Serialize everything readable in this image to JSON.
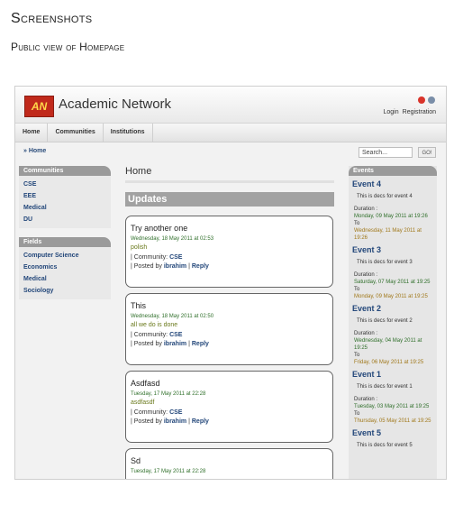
{
  "doc": {
    "heading": "Screenshots",
    "subheading": "Public view of Homepage"
  },
  "header": {
    "logo_text": "AN",
    "site_title": "Academic Network",
    "login": "Login",
    "registration": "Registration"
  },
  "nav": [
    "Home",
    "Communities",
    "Institutions"
  ],
  "breadcrumb": "» Home",
  "search": {
    "placeholder": "Search...",
    "go_label": "GO!"
  },
  "sidebar": {
    "communities_title": "Communities",
    "communities": [
      "CSE",
      "EEE",
      "Medical",
      "DU"
    ],
    "fields_title": "Fields",
    "fields": [
      "Computer Science",
      "Economics",
      "Medical",
      "Sociology"
    ]
  },
  "main": {
    "title": "Home",
    "updates_title": "Updates",
    "posts": [
      {
        "title": "Try another one",
        "date": "Wednesday, 18 May 2011 at 02:53",
        "body": "polish",
        "community_prefix": "| Community:",
        "community": "CSE",
        "posted_prefix": "| Posted by",
        "author": "ibrahim",
        "reply": "Reply"
      },
      {
        "title": "This",
        "date": "Wednesday, 18 May 2011 at 02:50",
        "body": "all we do is done",
        "community_prefix": "| Community:",
        "community": "CSE",
        "posted_prefix": "| Posted by",
        "author": "ibrahim",
        "reply": "Reply"
      },
      {
        "title": "Asdfasd",
        "date": "Tuesday, 17 May 2011 at 22:28",
        "body": "asdfasdf",
        "community_prefix": "| Community:",
        "community": "CSE",
        "posted_prefix": "| Posted by",
        "author": "ibrahim",
        "reply": "Reply"
      },
      {
        "title": "Sd",
        "date": "Tuesday, 17 May 2011 at 22:28",
        "body": "",
        "community_prefix": "",
        "community": "",
        "posted_prefix": "",
        "author": "",
        "reply": ""
      }
    ]
  },
  "events": {
    "title": "Events",
    "items": [
      {
        "title": "Event 4",
        "desc": "This is decs for event 4",
        "duration_label": "Duration :",
        "start": "Monday, 09 May 2011 at 19:26",
        "to": "To",
        "end": "Wednesday, 11 May 2011 at 19:26"
      },
      {
        "title": "Event 3",
        "desc": "This is decs for event 3",
        "duration_label": "Duration :",
        "start": "Saturday, 07 May 2011 at 19:25",
        "to": "To",
        "end": "Monday, 09 May 2011 at 19:25"
      },
      {
        "title": "Event 2",
        "desc": "This is decs for event 2",
        "duration_label": "Duration :",
        "start": "Wednesday, 04 May 2011 at 19:25",
        "to": "To",
        "end": "Friday, 06 May 2011 at 19:25"
      },
      {
        "title": "Event 1",
        "desc": "This is decs for event 1",
        "duration_label": "Duration :",
        "start": "Tuesday, 03 May 2011 at 19:25",
        "to": "To",
        "end": "Thursday, 05 May 2011 at 19:25"
      },
      {
        "title": "Event 5",
        "desc": "This is decs for event 5"
      }
    ]
  }
}
